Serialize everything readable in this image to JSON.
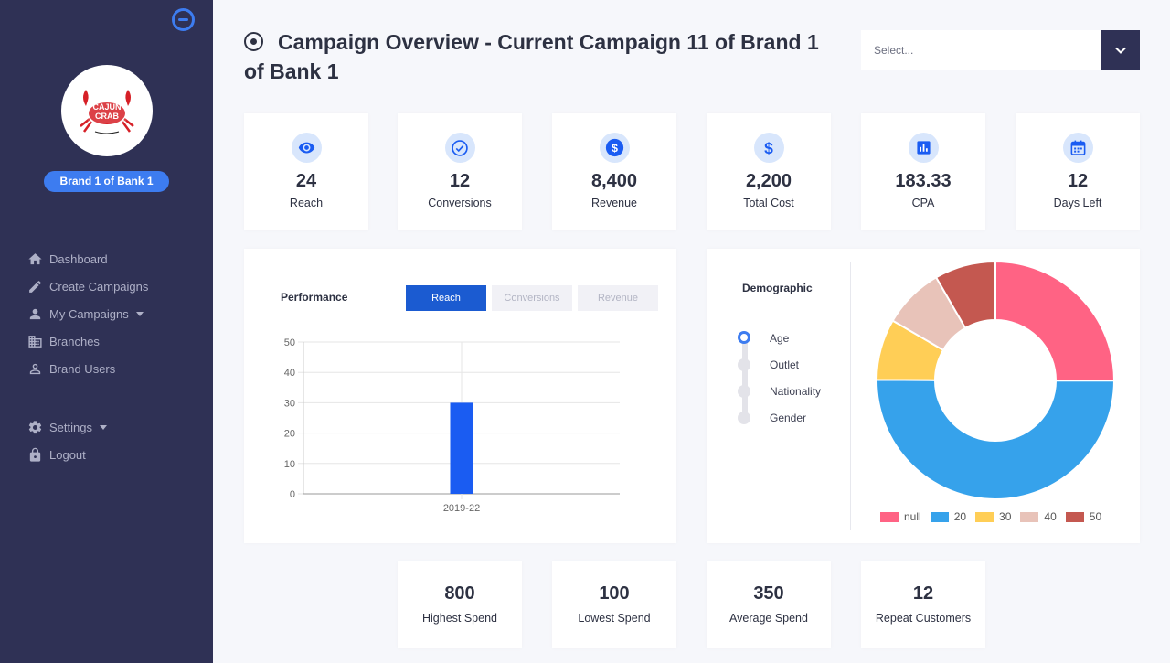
{
  "sidebar": {
    "brand_name": "Brand 1 of Bank 1",
    "logo_text": "CAJUN CRAB",
    "nav": [
      {
        "label": "Dashboard",
        "icon": "home-icon"
      },
      {
        "label": "Create Campaigns",
        "icon": "pencil-icon"
      },
      {
        "label": "My Campaigns",
        "icon": "user-icon"
      },
      {
        "label": "Branches",
        "icon": "building-icon"
      },
      {
        "label": "Brand Users",
        "icon": "user-outline-icon"
      }
    ],
    "settings": {
      "label": "Settings",
      "icon": "gear-icon"
    },
    "logout": {
      "label": "Logout",
      "icon": "lock-icon"
    }
  },
  "header": {
    "title": "Campaign Overview - Current Campaign 11 of Brand 1 of Bank 1",
    "select_placeholder": "Select..."
  },
  "stats": [
    {
      "value": "24",
      "label": "Reach",
      "icon": "eye-icon"
    },
    {
      "value": "12",
      "label": "Conversions",
      "icon": "check-circle-icon"
    },
    {
      "value": "8,400",
      "label": "Revenue",
      "icon": "dollar-circle-icon"
    },
    {
      "value": "2,200",
      "label": "Total Cost",
      "icon": "dollar-icon"
    },
    {
      "value": "183.33",
      "label": "CPA",
      "icon": "bar-chart-icon"
    },
    {
      "value": "12",
      "label": "Days Left",
      "icon": "calendar-icon"
    }
  ],
  "performance": {
    "title": "Performance",
    "tabs": [
      "Reach",
      "Conversions",
      "Revenue"
    ],
    "active_tab": "Reach"
  },
  "demographic": {
    "title": "Demographic",
    "options": [
      "Age",
      "Outlet",
      "Nationality",
      "Gender"
    ],
    "selected": "Age"
  },
  "bottom_stats": [
    {
      "value": "800",
      "label": "Highest Spend"
    },
    {
      "value": "100",
      "label": "Lowest Spend"
    },
    {
      "value": "350",
      "label": "Average Spend"
    },
    {
      "value": "12",
      "label": "Repeat Customers"
    }
  ],
  "colors": {
    "accent": "#3d7cf0",
    "sidebar": "#2f3155",
    "bar": "#1a5cf2"
  },
  "chart_data": [
    {
      "type": "bar",
      "categories": [
        "2019-22"
      ],
      "values": [
        30
      ],
      "ylim": [
        0,
        50
      ],
      "yticks": [
        0,
        10,
        20,
        30,
        40,
        50
      ],
      "grid": true
    },
    {
      "type": "pie",
      "labels": [
        "null",
        "20",
        "30",
        "40",
        "50"
      ],
      "values": [
        25,
        50,
        8.3,
        8.3,
        8.3
      ],
      "colors": [
        "#ff6384",
        "#36a2eb",
        "#ffce56",
        "#e8c3b9",
        "#c45850"
      ],
      "donut": true,
      "legend": "bottom"
    }
  ]
}
